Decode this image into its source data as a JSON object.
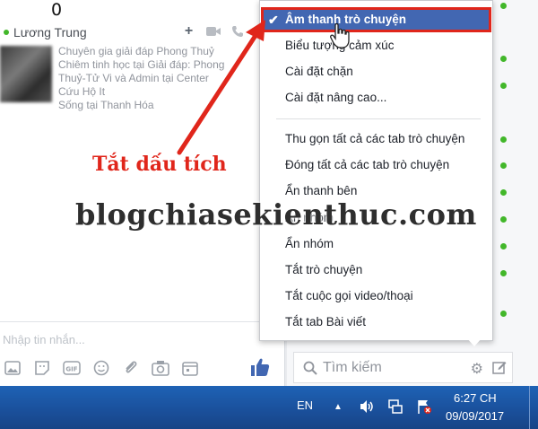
{
  "top_digit": "0",
  "chat": {
    "name": "Lương Trung",
    "profile_lines": [
      "Chuyên gia giải đáp Phong Thuỷ",
      "Chiêm tinh học tại Giải đáp: Phong",
      "Thuỷ-Tử Vi và Admin tại Center",
      "Cứu Hộ It",
      "Sống tại Thanh Hóa"
    ],
    "message_placeholder": "Nhập tin nhắn...",
    "header_icons": [
      "plus-icon",
      "video-icon",
      "phone-icon",
      "gear-icon"
    ],
    "toolbar_icons": [
      "image-icon",
      "sticker-icon",
      "gif-icon",
      "emoji-icon",
      "attachment-icon",
      "camera-icon",
      "calendar-icon"
    ],
    "like_icon": "thumbs-up-icon"
  },
  "menu": {
    "selected": "Âm thanh trò chuyện",
    "items_group1": [
      "Biểu tượng cảm xúc",
      "Cài đặt chặn",
      "Cài đặt nâng cao..."
    ],
    "items_group2": [
      "Thu gọn tất cả các tab trò chuyện",
      "Đóng tất cả các tab trò chuyện",
      "Ẩn thanh bên",
      "Ẩn nhóm",
      "Ẩn nhóm",
      "Tắt trò chuyện",
      "Tắt cuộc gọi video/thoại",
      "Tắt tab Bài viết"
    ]
  },
  "search": {
    "placeholder": "Tìm kiếm"
  },
  "annotation": {
    "label": "Tắt dấu tích"
  },
  "watermark": "blogchiasekienthuc.com",
  "taskbar": {
    "language": "EN",
    "time": "6:27 CH",
    "date": "09/09/2017"
  },
  "colors": {
    "menu_highlight": "#4267b2",
    "annotation_red": "#e0261b",
    "online_green": "#42b72a",
    "taskbar": "#1a4f9a"
  }
}
